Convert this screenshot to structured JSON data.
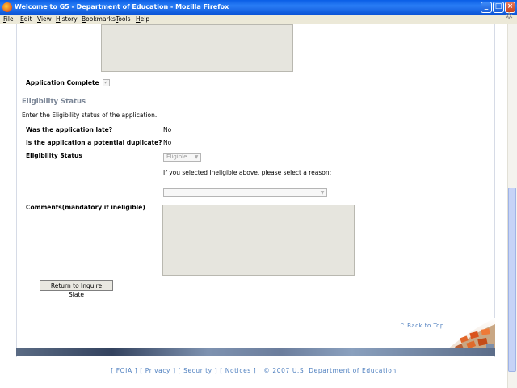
{
  "window": {
    "title": "Welcome to G5 - Department of Education - Mozilla Firefox"
  },
  "menu": [
    "File",
    "Edit",
    "View",
    "History",
    "Bookmarks",
    "Tools",
    "Help"
  ],
  "form": {
    "application_complete_label": "Application Complete",
    "application_complete_checked": true,
    "section_title": "Eligibility Status",
    "instructions": "Enter the Eligibility status of the application.",
    "late_label": "Was the application late?",
    "late_value": "No",
    "duplicate_label": "Is the application a potential duplicate?",
    "duplicate_value": "No",
    "eligibility_label": "Eligibility Status",
    "eligibility_selected": "Eligible",
    "reason_prompt": "If you selected Ineligible above, please select a reason:",
    "reason_selected": "",
    "comments_label": "Comments(mandatory if ineligible)",
    "comments_value": "",
    "return_button": "Return to Inquire Slate"
  },
  "back_to_top": "^ Back to Top",
  "footer": {
    "links": [
      "FOIA",
      "Privacy",
      "Security",
      "Notices"
    ],
    "copyright": "© 2007 U.S. Department of Education"
  }
}
